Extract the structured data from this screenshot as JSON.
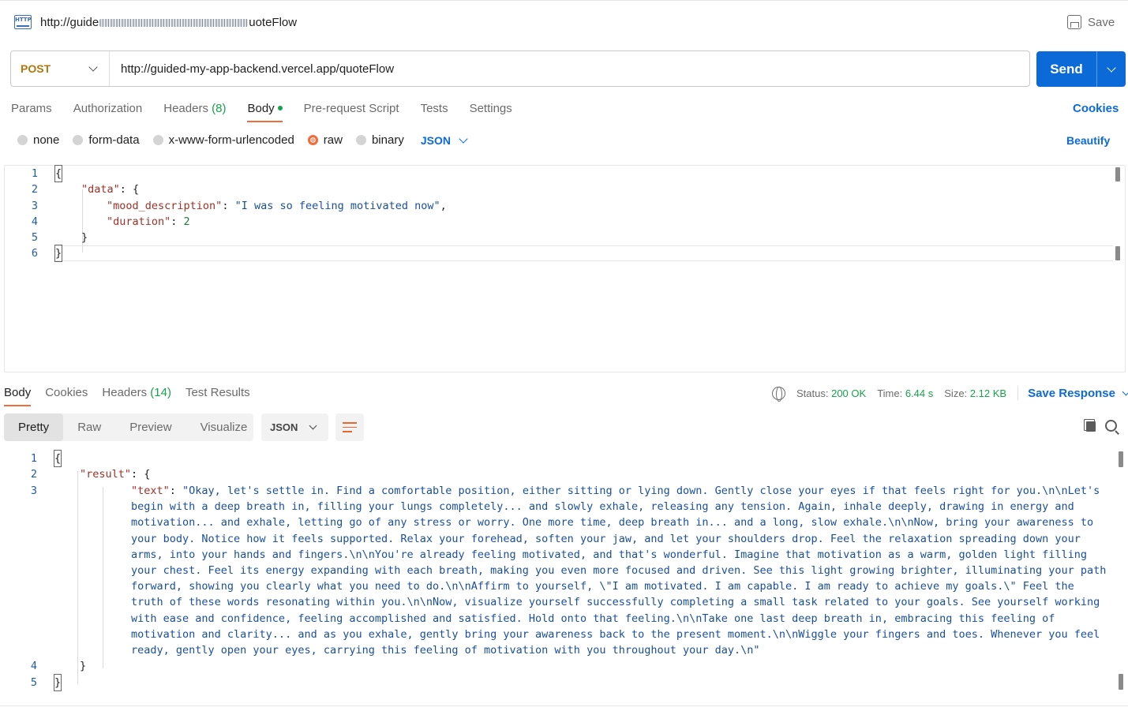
{
  "request": {
    "name_prefix": "http://guide",
    "name_suffix": "uoteFlow",
    "save_label": "Save",
    "method": "POST",
    "url": "http://guided-my-app-backend.vercel.app/quoteFlow",
    "send_label": "Send"
  },
  "request_tabs": {
    "params": "Params",
    "authorization": "Authorization",
    "headers": "Headers",
    "headers_count": "(8)",
    "body": "Body",
    "pre_request": "Pre-request Script",
    "tests": "Tests",
    "settings": "Settings",
    "cookies": "Cookies"
  },
  "body_types": {
    "none": "none",
    "form_data": "form-data",
    "urlencoded": "x-www-form-urlencoded",
    "raw": "raw",
    "binary": "binary",
    "format": "JSON",
    "beautify": "Beautify"
  },
  "request_body": {
    "line_numbers": [
      "1",
      "2",
      "3",
      "4",
      "5",
      "6"
    ],
    "open_brace": "{",
    "data_key": "\"data\"",
    "mood_key": "\"mood_description\"",
    "mood_value": "\"I was so feeling motivated now\"",
    "duration_key": "\"duration\"",
    "duration_value": "2",
    "inner_close": "}",
    "close_brace": "}"
  },
  "response_tabs": {
    "body": "Body",
    "cookies": "Cookies",
    "headers": "Headers",
    "headers_count": "(14)",
    "test_results": "Test Results"
  },
  "response_meta": {
    "status_label": "Status:",
    "status_value": "200 OK",
    "time_label": "Time:",
    "time_value": "6.44 s",
    "size_label": "Size:",
    "size_value": "2.12 KB",
    "save_response": "Save Response"
  },
  "response_views": {
    "pretty": "Pretty",
    "raw": "Raw",
    "preview": "Preview",
    "visualize": "Visualize",
    "format": "JSON"
  },
  "response_body": {
    "line_numbers": [
      "1",
      "2",
      "3",
      "4",
      "5"
    ],
    "open_brace": "{",
    "result_key": "\"result\"",
    "text_key": "\"text\"",
    "text_value": "\"Okay, let's settle in. Find a comfortable position, either sitting or lying down. Gently close your eyes if that feels right for you.\\n\\nLet's begin with a deep breath in, filling your lungs completely... and slowly exhale, releasing any tension. Again, inhale deeply, drawing in energy and motivation... and exhale, letting go of any stress or worry. One more time, deep breath in... and a long, slow exhale.\\n\\nNow, bring your awareness to your body. Notice how it feels supported. Relax your forehead, soften your jaw, and let your shoulders drop. Feel the relaxation spreading down your arms, into your hands and fingers.\\n\\nYou're already feeling motivated, and that's wonderful. Imagine that motivation as a warm, golden light filling your chest. Feel its energy expanding with each breath, making you even more focused and driven. See this light growing brighter, illuminating your path forward, showing you clearly what you need to do.\\n\\nAffirm to yourself, \\\"I am motivated. I am capable. I am ready to achieve my goals.\\\" Feel the truth of these words resonating within you.\\n\\nNow, visualize yourself successfully completing a small task related to your goals. See yourself working with ease and confidence, feeling accomplished and satisfied. Hold onto that feeling.\\n\\nTake one last deep breath in, embracing this feeling of motivation and clarity... and as you exhale, gently bring your awareness back to the present moment.\\n\\nWiggle your fingers and toes. Whenever you feel ready, gently open your eyes, carrying this feeling of motivation with you throughout your day.\\n\"",
    "inner_close": "}",
    "close_brace": "}"
  },
  "colors": {
    "accent": "#0c6ad8",
    "method": "#b3760a",
    "active_tab": "#f26b3a",
    "status": "#16a34a"
  }
}
